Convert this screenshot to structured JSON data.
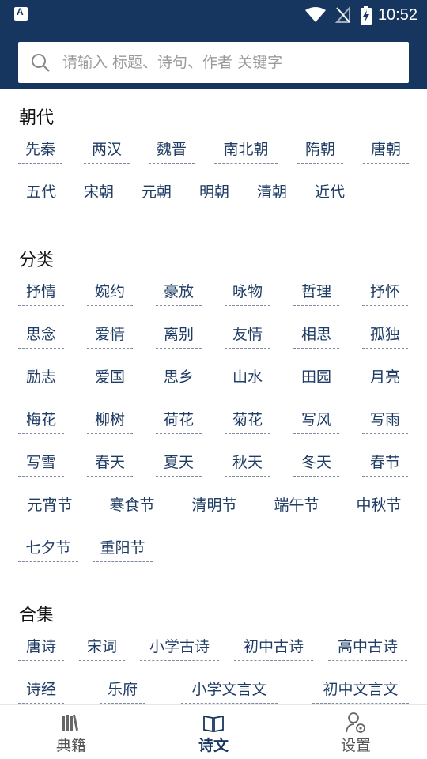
{
  "status": {
    "time": "10:52"
  },
  "search": {
    "placeholder": "请输入 标题、诗句、作者 关键字"
  },
  "sections": {
    "dynasty": {
      "title": "朝代",
      "items": [
        "先秦",
        "两汉",
        "魏晋",
        "南北朝",
        "隋朝",
        "唐朝",
        "五代",
        "宋朝",
        "元朝",
        "明朝",
        "清朝",
        "近代"
      ]
    },
    "category": {
      "title": "分类",
      "items": [
        "抒情",
        "婉约",
        "豪放",
        "咏物",
        "哲理",
        "抒怀",
        "思念",
        "爱情",
        "离别",
        "友情",
        "相思",
        "孤独",
        "励志",
        "爱国",
        "思乡",
        "山水",
        "田园",
        "月亮",
        "梅花",
        "柳树",
        "荷花",
        "菊花",
        "写风",
        "写雨",
        "写雪",
        "春天",
        "夏天",
        "秋天",
        "冬天",
        "春节",
        "元宵节",
        "寒食节",
        "清明节",
        "端午节",
        "中秋节",
        "七夕节",
        "重阳节"
      ]
    },
    "collection": {
      "title": "合集",
      "items": [
        "唐诗",
        "宋词",
        "小学古诗",
        "初中古诗",
        "高中古诗",
        "诗经",
        "乐府",
        "小学文言文",
        "初中文言文"
      ]
    }
  },
  "nav": {
    "items": [
      {
        "label": "典籍",
        "icon": "books-icon"
      },
      {
        "label": "诗文",
        "icon": "open-book-icon"
      },
      {
        "label": "设置",
        "icon": "user-settings-icon"
      }
    ]
  },
  "colors": {
    "primary": "#17365f",
    "tag_text": "#1f3c64",
    "background": "#ffffff"
  }
}
